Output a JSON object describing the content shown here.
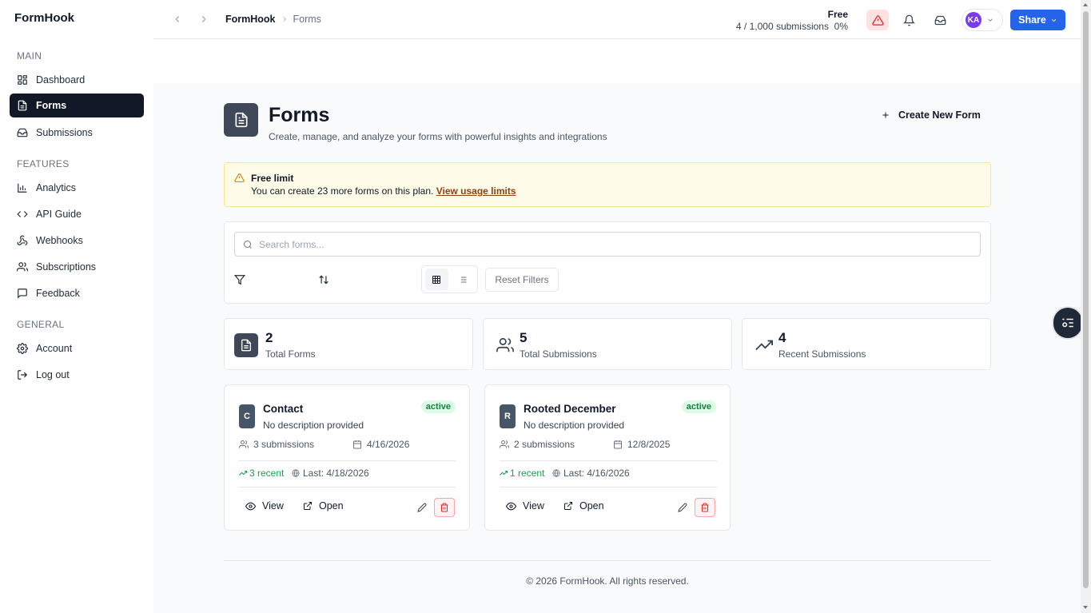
{
  "app": {
    "name": "FormHook"
  },
  "sidebar": {
    "sections": [
      {
        "title": "MAIN",
        "items": [
          {
            "label": "Dashboard",
            "icon": "dashboard-icon"
          },
          {
            "label": "Forms",
            "icon": "file-text-icon",
            "active": true
          },
          {
            "label": "Submissions",
            "icon": "inbox-icon"
          }
        ]
      },
      {
        "title": "FEATURES",
        "items": [
          {
            "label": "Analytics",
            "icon": "bar-chart-icon"
          },
          {
            "label": "API Guide",
            "icon": "code-icon"
          },
          {
            "label": "Webhooks",
            "icon": "webhook-icon"
          },
          {
            "label": "Subscriptions",
            "icon": "users-icon"
          },
          {
            "label": "Feedback",
            "icon": "message-square-icon"
          }
        ]
      },
      {
        "title": "GENERAL",
        "items": [
          {
            "label": "Account",
            "icon": "gear-icon"
          },
          {
            "label": "Log out",
            "icon": "log-out-icon"
          }
        ]
      }
    ]
  },
  "topbar": {
    "breadcrumb": {
      "current": "FormHook",
      "page": "Forms"
    },
    "plan": {
      "name": "Free",
      "usage": "4 / 1,000 submissions",
      "percent": "0%"
    },
    "user": {
      "initials": "KA"
    },
    "share_label": "Share",
    "accent": "#2563eb"
  },
  "page": {
    "title": "Forms",
    "subtitle": "Create, manage, and analyze your forms with powerful insights and integrations",
    "create_label": "Create New Form"
  },
  "alert": {
    "title": "Free limit",
    "message": "You can create 23 more forms on this plan.",
    "link": "View usage limits"
  },
  "filters": {
    "search_placeholder": "Search forms...",
    "reset_label": "Reset Filters"
  },
  "stats": [
    {
      "value": "2",
      "label": "Total Forms",
      "icon": "file-text-icon"
    },
    {
      "value": "5",
      "label": "Total Submissions",
      "icon": "users-icon"
    },
    {
      "value": "4",
      "label": "Recent Submissions",
      "icon": "trending-up-icon"
    }
  ],
  "forms": [
    {
      "initial": "C",
      "name": "Contact",
      "description": "No description provided",
      "status": "active",
      "submissions": "3 submissions",
      "date": "4/16/2026",
      "recent": "3 recent",
      "last": "Last: 4/18/2026",
      "view_label": "View",
      "open_label": "Open"
    },
    {
      "initial": "R",
      "name": "Rooted December",
      "description": "No description provided",
      "status": "active",
      "submissions": "2 submissions",
      "date": "12/8/2025",
      "recent": "1 recent",
      "last": "Last: 4/16/2026",
      "view_label": "View",
      "open_label": "Open"
    }
  ],
  "footer": {
    "text": "© 2026 FormHook. All rights reserved."
  }
}
